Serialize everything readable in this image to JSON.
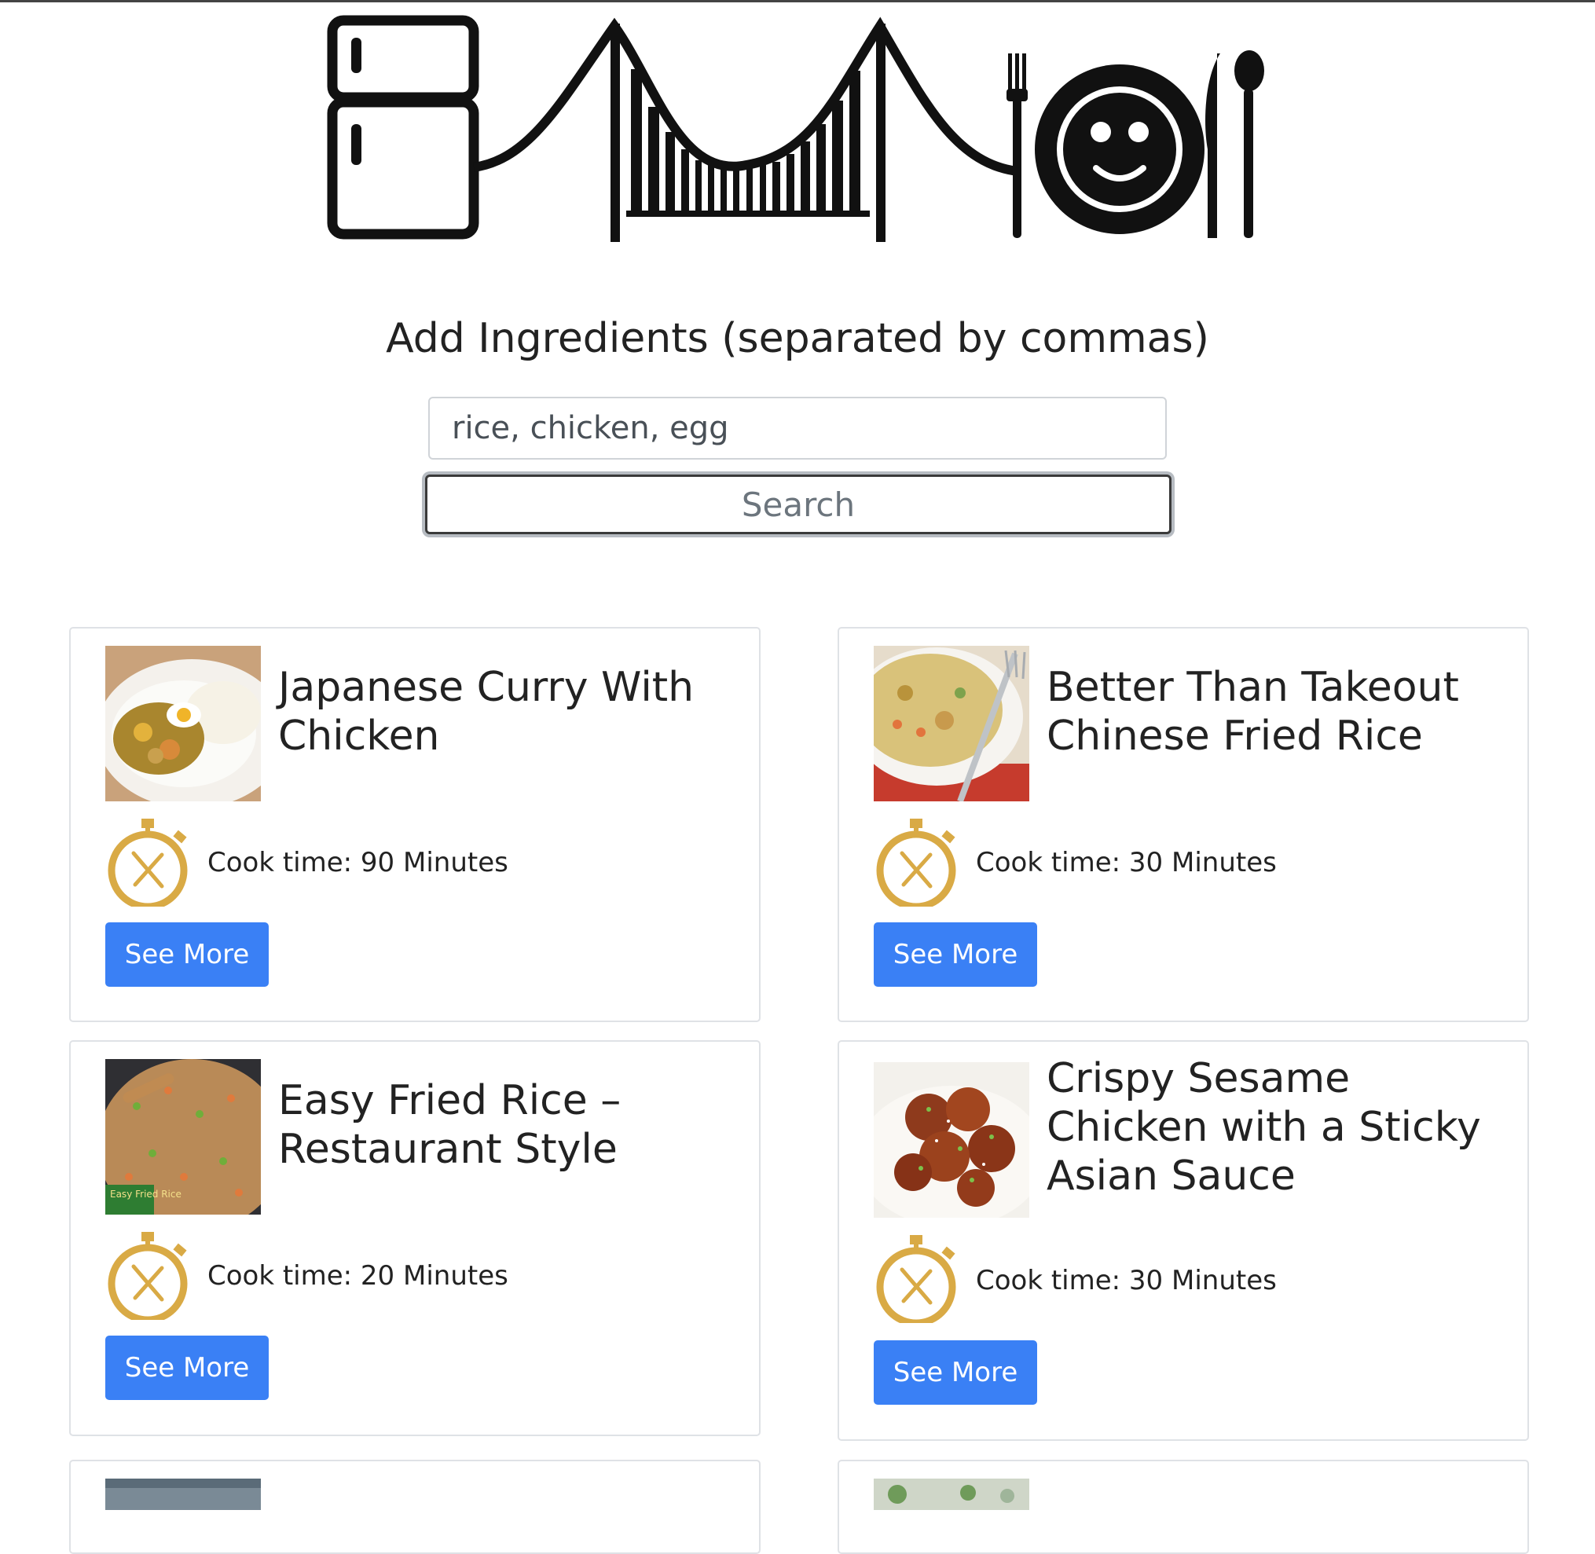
{
  "search": {
    "title": "Add Ingredients (separated by commas)",
    "input_value": "rice, chicken, egg",
    "button_label": "Search"
  },
  "accent": {
    "button_blue": "#3a80f5",
    "timer_gold": "#d9aa45"
  },
  "recipes": [
    {
      "title": "Japanese Curry With Chicken",
      "cook_time": "Cook time: 90 Minutes",
      "button_label": "See More",
      "image_icon": "curry-photo"
    },
    {
      "title": "Better Than Takeout Chinese Fried Rice",
      "cook_time": "Cook time: 30 Minutes",
      "button_label": "See More",
      "image_icon": "fried-rice-photo"
    },
    {
      "title": "Easy Fried Rice – Restaurant Style",
      "cook_time": "Cook time: 20 Minutes",
      "button_label": "See More",
      "image_icon": "wok-fried-rice-photo",
      "image_caption": "Easy Fried Rice"
    },
    {
      "title": "Crispy Sesame Chicken with a Sticky Asian Sauce",
      "cook_time": "Cook time: 30 Minutes",
      "button_label": "See More",
      "image_icon": "sesame-chicken-photo"
    }
  ]
}
